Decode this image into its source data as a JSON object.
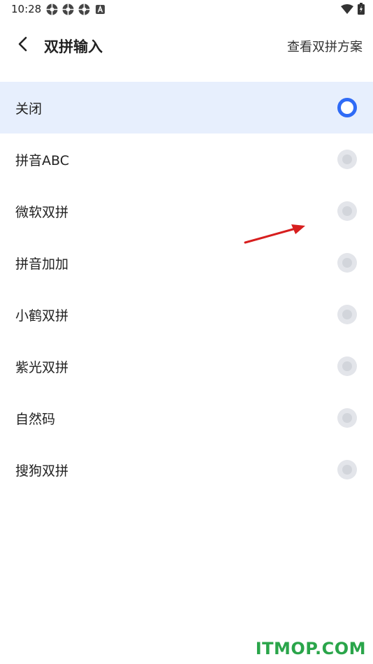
{
  "status_bar": {
    "time": "10:28",
    "left_icons": [
      "app-notification-icon",
      "app-notification-icon",
      "app-notification-icon",
      "a-badge-icon"
    ],
    "right_icons": [
      "wifi-icon",
      "battery-icon"
    ]
  },
  "header": {
    "back_icon": "chevron-left-icon",
    "title": "双拼输入",
    "action_label": "查看双拼方案"
  },
  "options": [
    {
      "label": "关闭",
      "selected": true
    },
    {
      "label": "拼音ABC",
      "selected": false
    },
    {
      "label": "微软双拼",
      "selected": false
    },
    {
      "label": "拼音加加",
      "selected": false
    },
    {
      "label": "小鹤双拼",
      "selected": false
    },
    {
      "label": "紫光双拼",
      "selected": false
    },
    {
      "label": "自然码",
      "selected": false
    },
    {
      "label": "搜狗双拼",
      "selected": false
    }
  ],
  "colors": {
    "accent": "#2f6bf6",
    "selected_row_bg": "#e7effd",
    "annotation_arrow": "#d71e1e",
    "watermark": "#2aa54a"
  },
  "watermark": "ITMOP.COM"
}
